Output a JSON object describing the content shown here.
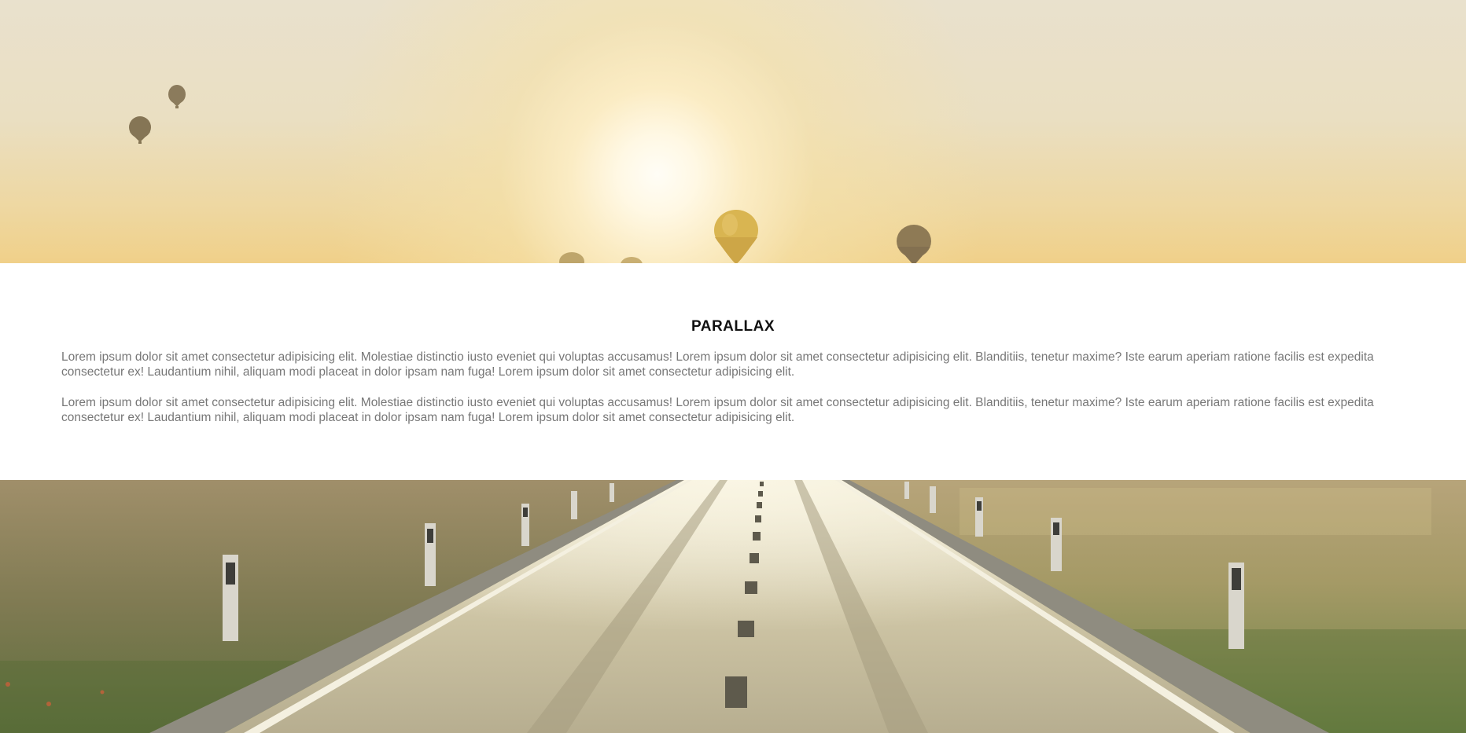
{
  "section": {
    "title": "PARALLAX",
    "paragraphs": [
      "Lorem ipsum dolor sit amet consectetur adipisicing elit. Molestiae distinctio iusto eveniet qui voluptas accusamus! Lorem ipsum dolor sit amet consectetur adipisicing elit. Blanditiis, tenetur maxime? Iste earum aperiam ratione facilis est expedita consectetur ex! Laudantium nihil, aliquam modi placeat in dolor ipsam nam fuga! Lorem ipsum dolor sit amet consectetur adipisicing elit.",
      "Lorem ipsum dolor sit amet consectetur adipisicing elit. Molestiae distinctio iusto eveniet qui voluptas accusamus! Lorem ipsum dolor sit amet consectetur adipisicing elit. Blanditiis, tenetur maxime? Iste earum aperiam ratione facilis est expedita consectetur ex! Laudantium nihil, aliquam modi placeat in dolor ipsam nam fuga! Lorem ipsum dolor sit amet consectetur adipisicing elit."
    ]
  },
  "images": {
    "top": "sunset-balloons-photo",
    "bottom": "country-road-photo"
  },
  "colors": {
    "title": "#111111",
    "body_text": "#777777",
    "background": "#ffffff"
  }
}
